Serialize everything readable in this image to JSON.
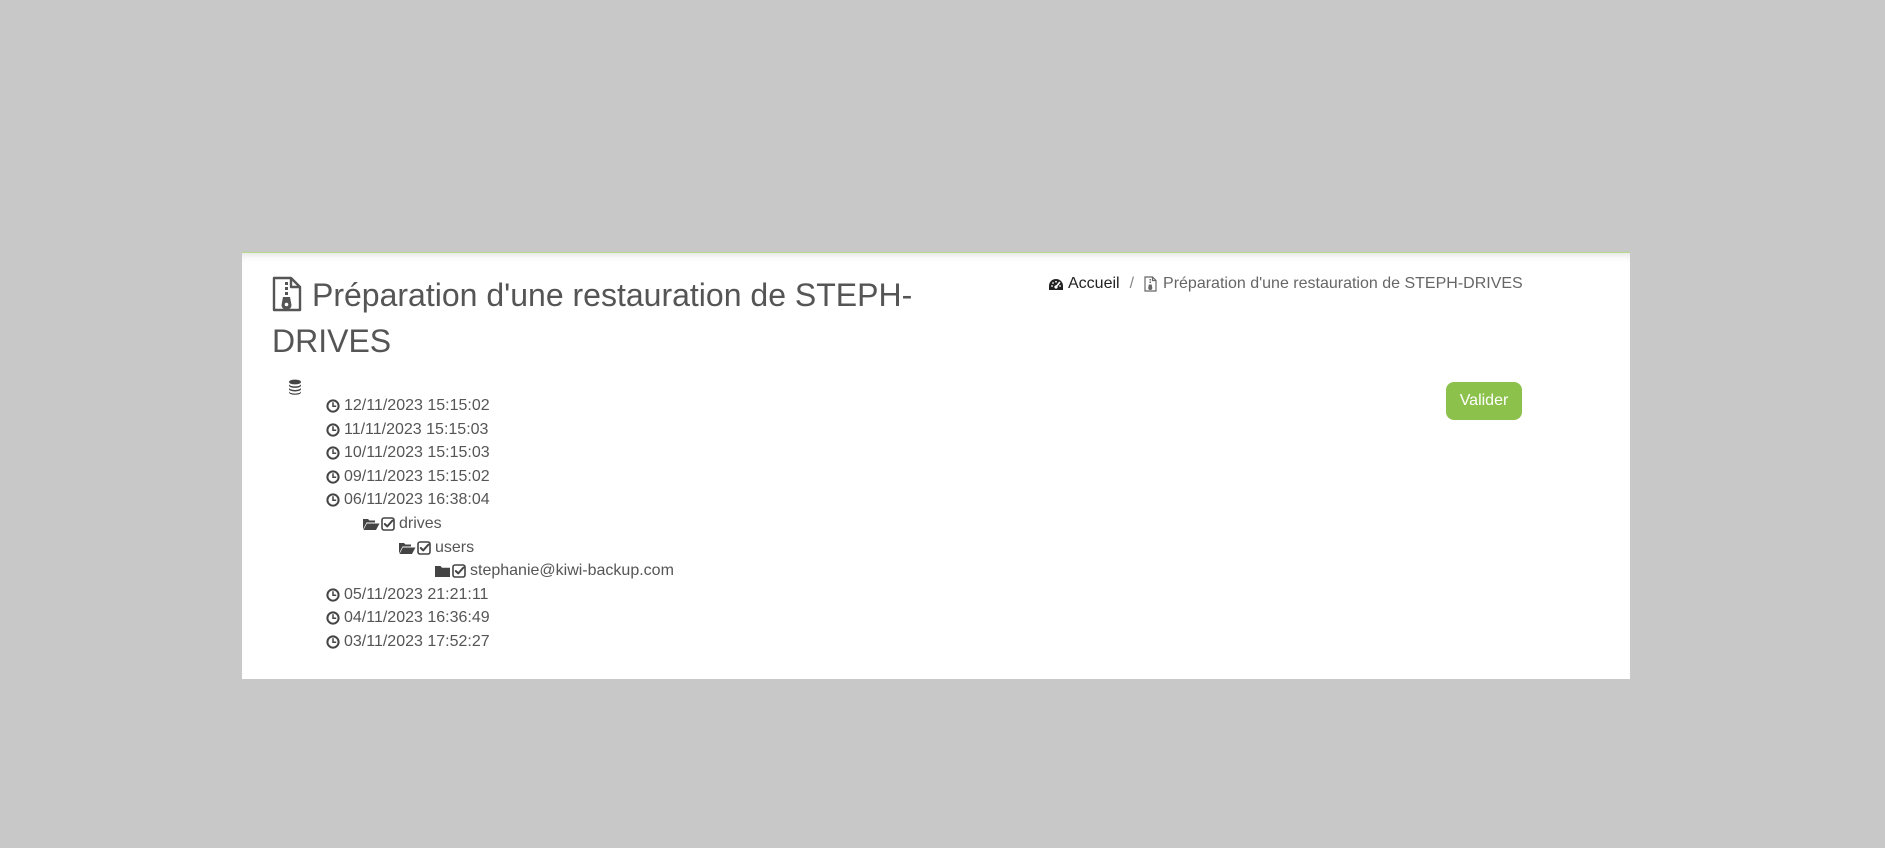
{
  "page": {
    "title": "Préparation d'une restauration de STEPH-DRIVES"
  },
  "breadcrumb": {
    "home_label": "Accueil",
    "separator": "/",
    "current_label": "Préparation d'une restauration de STEPH-DRIVES"
  },
  "actions": {
    "validate_label": "Valider"
  },
  "colors": {
    "accent": "#8cc14c",
    "background": "#c8c8c8",
    "panel": "#ffffff",
    "text": "#555555"
  },
  "tree": {
    "root_icon": "database-icon",
    "snapshots": [
      {
        "label": "12/11/2023 15:15:02"
      },
      {
        "label": "11/11/2023 15:15:03"
      },
      {
        "label": "10/11/2023 15:15:03"
      },
      {
        "label": "09/11/2023 15:15:02"
      },
      {
        "label": "06/11/2023 16:38:04"
      },
      {
        "label": "05/11/2023 21:21:11"
      },
      {
        "label": "04/11/2023 16:36:49"
      },
      {
        "label": "03/11/2023 17:52:27"
      }
    ],
    "folders": [
      {
        "label": "drives",
        "icon": "folder-open-icon",
        "checked": true
      },
      {
        "label": "users",
        "icon": "folder-open-icon",
        "checked": true
      },
      {
        "label": "stephanie@kiwi-backup.com",
        "icon": "folder-icon",
        "checked": true
      }
    ]
  }
}
